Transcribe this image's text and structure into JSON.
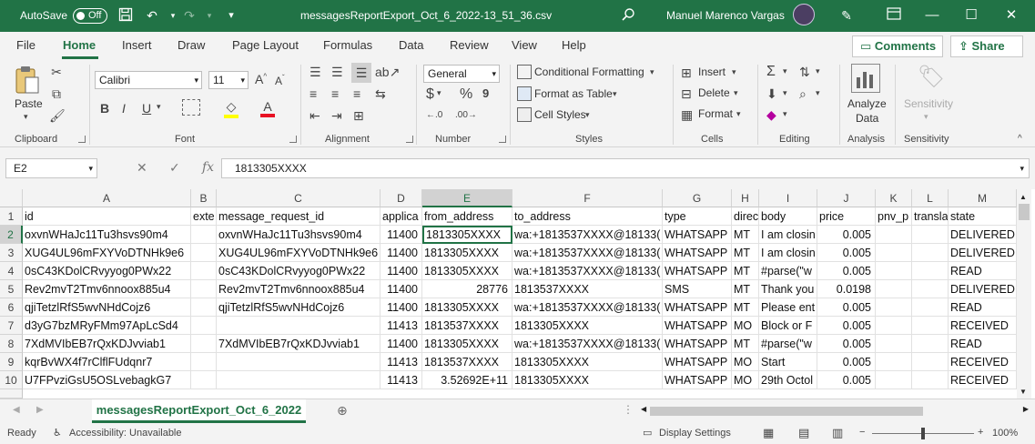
{
  "title_bar": {
    "autosave_label": "AutoSave",
    "autosave_state": "Off",
    "filename": "messagesReportExport_Oct_6_2022-13_51_36.csv",
    "user_name": "Manuel Marenco Vargas"
  },
  "menu_tabs": [
    "File",
    "Home",
    "Insert",
    "Draw",
    "Page Layout",
    "Formulas",
    "Data",
    "Review",
    "View",
    "Help"
  ],
  "active_tab": "Home",
  "top_buttons": {
    "comments": "Comments",
    "share": "Share"
  },
  "ribbon": {
    "clipboard": {
      "paste": "Paste",
      "group": "Clipboard"
    },
    "font": {
      "name": "Calibri",
      "size": "11",
      "group": "Font"
    },
    "alignment": {
      "group": "Alignment"
    },
    "number": {
      "format": "General",
      "group": "Number"
    },
    "styles": {
      "conditional": "Conditional Formatting",
      "table": "Format as Table",
      "cell_styles": "Cell Styles",
      "group": "Styles"
    },
    "cells": {
      "insert": "Insert",
      "delete": "Delete",
      "format": "Format",
      "group": "Cells"
    },
    "editing": {
      "group": "Editing"
    },
    "analysis": {
      "analyze_line1": "Analyze",
      "analyze_line2": "Data",
      "group": "Analysis"
    },
    "sensitivity": {
      "label": "Sensitivity",
      "group": "Sensitivity"
    }
  },
  "formula_bar": {
    "name_box": "E2",
    "value": "1813305XXXX"
  },
  "columns": [
    "A",
    "B",
    "C",
    "D",
    "E",
    "F",
    "G",
    "H",
    "I",
    "J",
    "K",
    "L",
    "M"
  ],
  "rows": [
    {
      "n": "1",
      "cells": [
        "id",
        "exte",
        "message_request_id",
        "applica",
        "from_address",
        "to_address",
        "type",
        "direc",
        "body",
        "price",
        "pnv_p",
        "transla",
        "state"
      ]
    },
    {
      "n": "2",
      "cells": [
        "oxvnWHaJc11Tu3hsvs90m4",
        "",
        "oxvnWHaJc11Tu3hsvs90m4",
        "11400",
        "1813305XXXX",
        "wa:+1813537XXXX@18133(",
        "WHATSAPP",
        "MT",
        "I am closin",
        "0.005",
        "",
        "",
        "DELIVERED"
      ]
    },
    {
      "n": "3",
      "cells": [
        "XUG4UL96mFXYVoDTNHk9e6",
        "",
        "XUG4UL96mFXYVoDTNHk9e6",
        "11400",
        "1813305XXXX",
        "wa:+1813537XXXX@18133(",
        "WHATSAPP",
        "MT",
        "I am closin",
        "0.005",
        "",
        "",
        "DELIVERED"
      ]
    },
    {
      "n": "4",
      "cells": [
        "0sC43KDolCRvyyog0PWx22",
        "",
        "0sC43KDolCRvyyog0PWx22",
        "11400",
        "1813305XXXX",
        "wa:+1813537XXXX@18133(",
        "WHATSAPP",
        "MT",
        "#parse(\"w",
        "0.005",
        "",
        "",
        "READ"
      ]
    },
    {
      "n": "5",
      "cells": [
        "Rev2mvT2Tmv6nnoox885u4",
        "",
        "Rev2mvT2Tmv6nnoox885u4",
        "11400",
        "28776",
        "1813537XXXX",
        "SMS",
        "MT",
        "Thank you",
        "0.0198",
        "",
        "",
        "DELIVERED"
      ]
    },
    {
      "n": "6",
      "cells": [
        "qjiTetzlRfS5wvNHdCojz6",
        "",
        "qjiTetzlRfS5wvNHdCojz6",
        "11400",
        "1813305XXXX",
        "wa:+1813537XXXX@18133(",
        "WHATSAPP",
        "MT",
        "Please ent",
        "0.005",
        "",
        "",
        "READ"
      ]
    },
    {
      "n": "7",
      "cells": [
        "d3yG7bzMRyFMm97ApLcSd4",
        "",
        "",
        "11413",
        "1813537XXXX",
        "1813305XXXX",
        "WHATSAPP",
        "MO",
        "Block or F",
        "0.005",
        "",
        "",
        "RECEIVED"
      ]
    },
    {
      "n": "8",
      "cells": [
        "7XdMVIbEB7rQxKDJvviab1",
        "",
        "7XdMVIbEB7rQxKDJvviab1",
        "11400",
        "1813305XXXX",
        "wa:+1813537XXXX@18133(",
        "WHATSAPP",
        "MT",
        "#parse(\"w",
        "0.005",
        "",
        "",
        "READ"
      ]
    },
    {
      "n": "9",
      "cells": [
        "kqrBvWX4f7rClflFUdqnr7",
        "",
        "",
        "11413",
        "1813537XXXX",
        "1813305XXXX",
        "WHATSAPP",
        "MO",
        "Start",
        "0.005",
        "",
        "",
        "RECEIVED"
      ]
    },
    {
      "n": "10",
      "cells": [
        "U7FPvziGsU5OSLvebagkG7",
        "",
        "",
        "11413",
        "3.52692E+11",
        "1813305XXXX",
        "WHATSAPP",
        "MO",
        "29th Octol",
        "0.005",
        "",
        "",
        "RECEIVED"
      ]
    }
  ],
  "sheet_tab": "messagesReportExport_Oct_6_2022",
  "status": {
    "ready": "Ready",
    "accessibility": "Accessibility: Unavailable",
    "display": "Display Settings",
    "zoom": "100%"
  }
}
